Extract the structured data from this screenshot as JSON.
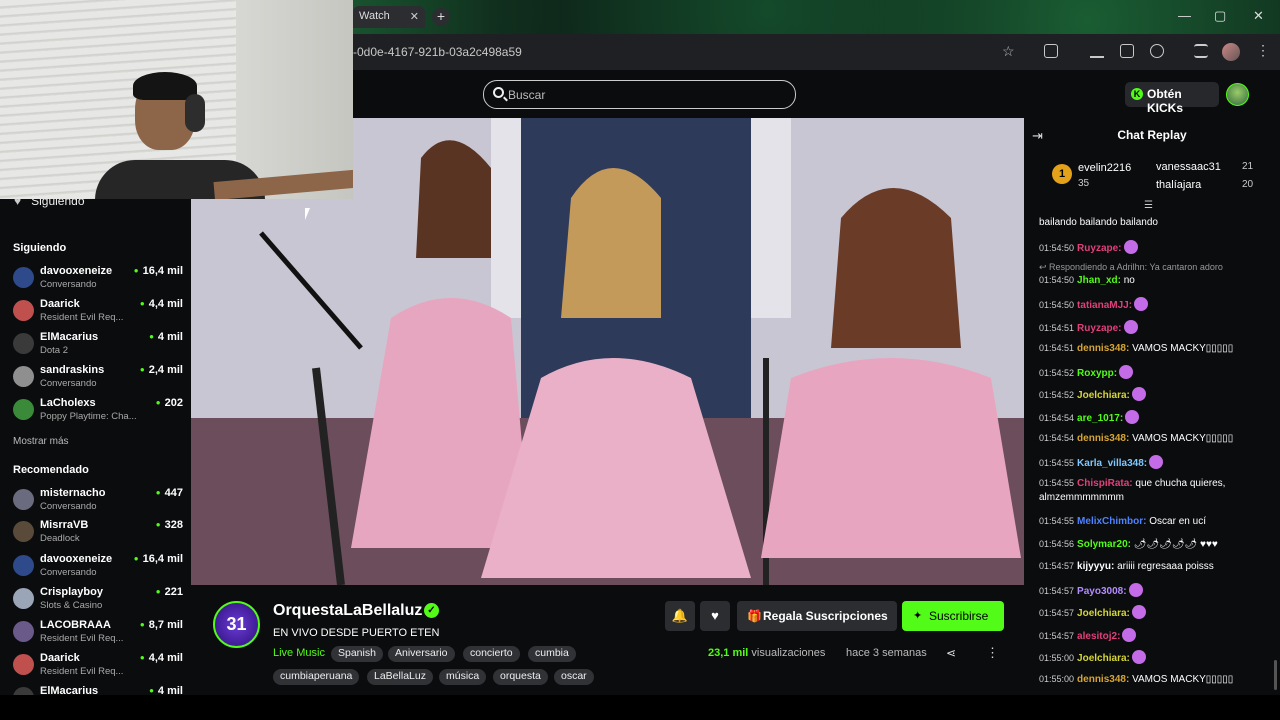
{
  "browser": {
    "tab_label": "Watch",
    "url_fragment": "-0d0e-4167-921b-03a2c498a59"
  },
  "header": {
    "search_placeholder": "Buscar",
    "kicks_button": "Obtén KICKs"
  },
  "sidebar": {
    "toggle_label": "Siguiendo",
    "following_title": "Siguiendo",
    "following": [
      {
        "name": "davooxeneize",
        "sub": "Conversando",
        "count": "16,4 mil",
        "color": "#2f4a8a"
      },
      {
        "name": "Daarick",
        "sub": "Resident Evil Req...",
        "count": "4,4 mil",
        "color": "#c0504d"
      },
      {
        "name": "ElMacarius",
        "sub": "Dota 2",
        "count": "4 mil",
        "color": "#3a3a3a"
      },
      {
        "name": "sandraskins",
        "sub": "Conversando",
        "count": "2,4 mil",
        "color": "#8f8f8f"
      },
      {
        "name": "LaCholexs",
        "sub": "Poppy Playtime: Cha...",
        "count": "202",
        "color": "#3b8a3a"
      }
    ],
    "show_more": "Mostrar más",
    "recommended_title": "Recomendado",
    "recommended": [
      {
        "name": "misternacho",
        "sub": "Conversando",
        "count": "447",
        "color": "#6b6b80"
      },
      {
        "name": "MisrraVB",
        "sub": "Deadlock",
        "count": "328",
        "color": "#5a4a3a"
      },
      {
        "name": "davooxeneize",
        "sub": "Conversando",
        "count": "16,4 mil",
        "color": "#2f4a8a"
      },
      {
        "name": "Crisplayboy",
        "sub": "Slots & Casino",
        "count": "221",
        "color": "#9aa6b8"
      },
      {
        "name": "LACOBRAAA",
        "sub": "Resident Evil Req...",
        "count": "8,7 mil",
        "color": "#6a5a8a"
      },
      {
        "name": "Daarick",
        "sub": "Resident Evil Req...",
        "count": "4,4 mil",
        "color": "#c0504d"
      },
      {
        "name": "ElMacarius",
        "sub": "",
        "count": "4 mil",
        "color": "#3a3a3a"
      }
    ]
  },
  "stream": {
    "avatar_text": "31",
    "name": "OrquestaLaBellaluz",
    "title": "EN VIVO DESDE PUERTO ETEN",
    "category": "Live Music",
    "tags_row1": [
      "Spanish",
      "Aniversario",
      "concierto",
      "cumbia"
    ],
    "tags_row2": [
      "cumbiaperuana",
      "LaBellaLuz",
      "música",
      "orquesta",
      "oscar"
    ],
    "gift_button": "Regala Suscripciones",
    "subscribe_button": "Suscribirse",
    "views_count": "23,1 mil",
    "views_label": "visualizaciones",
    "when": "hace 3 semanas"
  },
  "chat": {
    "title": "Chat Replay",
    "top_gifter": {
      "rank": "1",
      "name": "evelin2216",
      "count": "35"
    },
    "gifter2": {
      "name": "vanessaac31",
      "count": "21"
    },
    "gifter3": {
      "name": "thalíajara",
      "count": "20"
    },
    "first_line": "bailando   bailando   bailando",
    "reply_note": "↩ Respondiendo a Adrilhn: Ya cantaron adoro",
    "messages": [
      {
        "time": "01:54:50",
        "user": "Ruyzape:",
        "text": "",
        "color": "#e0407a",
        "emote": true
      },
      {
        "time": "01:54:50",
        "user": "Jhan_xd:",
        "text": "no",
        "color": "#53fc18",
        "emote": false
      },
      {
        "time": "01:54:50",
        "user": "tatianaMJJ:",
        "text": "",
        "color": "#e0407a",
        "emote": true
      },
      {
        "time": "01:54:51",
        "user": "Ruyzape:",
        "text": "",
        "color": "#e0407a",
        "emote": true
      },
      {
        "time": "01:54:51",
        "user": "dennis348:",
        "text": "VAMOS MACKY▯▯▯▯▯",
        "color": "#d6a535",
        "emote": false
      },
      {
        "time": "01:54:52",
        "user": "Roxypp:",
        "text": "",
        "color": "#53fc18",
        "emote": true
      },
      {
        "time": "01:54:52",
        "user": "Joelchiara:",
        "text": "",
        "color": "#d6d635",
        "emote": true
      },
      {
        "time": "01:54:54",
        "user": "are_1017:",
        "text": "",
        "color": "#53fc18",
        "emote": true
      },
      {
        "time": "01:54:54",
        "user": "dennis348:",
        "text": "VAMOS MACKY▯▯▯▯▯",
        "color": "#d6a535",
        "emote": false
      },
      {
        "time": "01:54:55",
        "user": "Karla_villa348:",
        "text": "",
        "color": "#7fc7ff",
        "emote": true
      },
      {
        "time": "01:54:55",
        "user": "ChispiRata:",
        "text": "que chucha quieres,",
        "color": "#e0407a",
        "emote": false
      },
      {
        "time": "",
        "user": "",
        "text": "almzemmmmmmm",
        "color": "#fff",
        "emote": false
      },
      {
        "time": "01:54:55",
        "user": "MelixChimbor:",
        "text": "Oscar en ucí",
        "color": "#4f82ff",
        "emote": false
      },
      {
        "time": "01:54:56",
        "user": "Solymar20:",
        "text": "🌶🌶🌶🌶🌶 ♥♥♥",
        "color": "#53fc18",
        "emote": false
      },
      {
        "time": "01:54:57",
        "user": "kijyyyu:",
        "text": "ariiii regresaaa poisss",
        "color": "#ffffff",
        "emote": false
      },
      {
        "time": "01:54:57",
        "user": "Payo3008:",
        "text": "",
        "color": "#b38cff",
        "emote": true
      },
      {
        "time": "01:54:57",
        "user": "Joelchiara:",
        "text": "",
        "color": "#d6d635",
        "emote": true
      },
      {
        "time": "01:54:57",
        "user": "alesitoj2:",
        "text": "",
        "color": "#e0407a",
        "emote": true
      },
      {
        "time": "01:55:00",
        "user": "Joelchiara:",
        "text": "",
        "color": "#d6d635",
        "emote": true
      },
      {
        "time": "01:55:00",
        "user": "dennis348:",
        "text": "VAMOS MACKY▯▯▯▯▯",
        "color": "#d6a535",
        "emote": false
      }
    ]
  }
}
